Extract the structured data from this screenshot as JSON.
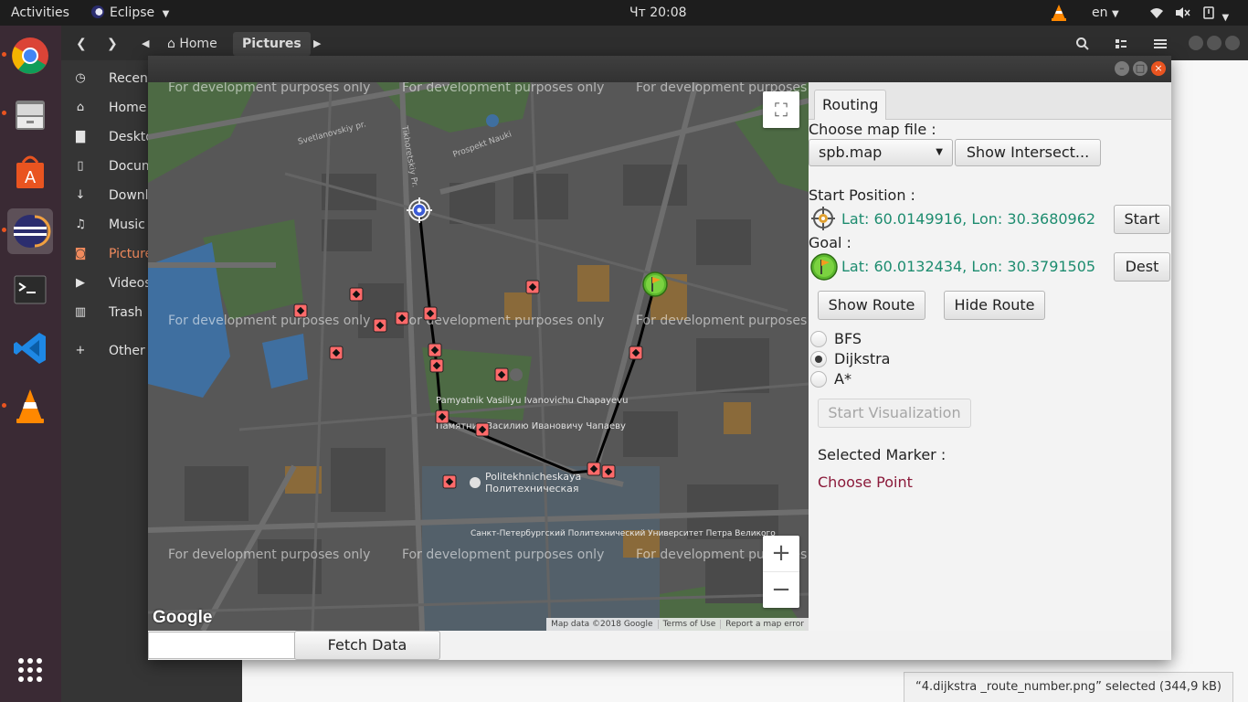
{
  "topbar": {
    "activities": "Activities",
    "app_menu": "Eclipse",
    "clock": "Чт 20:08",
    "lang": "en"
  },
  "files": {
    "breadcrumbs": [
      "Home",
      "Pictures"
    ],
    "sidebar": [
      {
        "icon": "clock-icon",
        "label": "Recent"
      },
      {
        "icon": "home-icon",
        "label": "Home"
      },
      {
        "icon": "folder-icon",
        "label": "Desktop"
      },
      {
        "icon": "document-icon",
        "label": "Documents"
      },
      {
        "icon": "download-icon",
        "label": "Downloads"
      },
      {
        "icon": "music-icon",
        "label": "Music"
      },
      {
        "icon": "camera-icon",
        "label": "Pictures"
      },
      {
        "icon": "video-icon",
        "label": "Videos"
      },
      {
        "icon": "trash-icon",
        "label": "Trash"
      },
      {
        "icon": "plus-icon",
        "label": "Other Locations"
      }
    ],
    "status": "“4.dijkstra _route_number.png” selected  (344,9 kB)"
  },
  "map": {
    "watermark": "For development purposes only",
    "labels": [
      "Svetlanovskiy pr.",
      "Prospekt Nauki",
      "Tikhoretskiy Pr.",
      "Pamyatnik Vasiliyu Ivanovichu Chapayevu",
      "Памятник Василию Ивановичу Чапаеву",
      "Politekhnicheskaya",
      "Политехническая",
      "Санкт-Петербургский Политехнический Университет Петра Великого",
      "Google"
    ],
    "attribution": [
      "Map data ©2018 Google",
      "Terms of Use",
      "Report a map error"
    ],
    "zoom_in": "+",
    "zoom_out": "−"
  },
  "panel": {
    "tab": "Routing",
    "choose_map_label": "Choose map file :",
    "map_file": "spb.map",
    "show_intersections": "Show Intersect...",
    "start_label": "Start Position :",
    "start_coords": "Lat: 60.0149916, Lon: 30.3680962",
    "start_button": "Start",
    "goal_label": "Goal :",
    "goal_coords": "Lat: 60.0132434, Lon: 30.3791505",
    "dest_button": "Dest",
    "show_route": "Show Route",
    "hide_route": "Hide Route",
    "algorithms": [
      {
        "label": "BFS",
        "selected": false
      },
      {
        "label": "Dijkstra",
        "selected": true
      },
      {
        "label": "A*",
        "selected": false
      }
    ],
    "start_visualization": "Start Visualization",
    "selected_marker_label": "Selected Marker :",
    "selected_marker_value": "Choose Point"
  },
  "bottom": {
    "fetch_input": "",
    "fetch_button": "Fetch Data"
  },
  "colors": {
    "accent": "#e95420",
    "coords": "#1d8c6f",
    "choose_point": "#8b1a3a",
    "marker": "#ff6a6a"
  }
}
